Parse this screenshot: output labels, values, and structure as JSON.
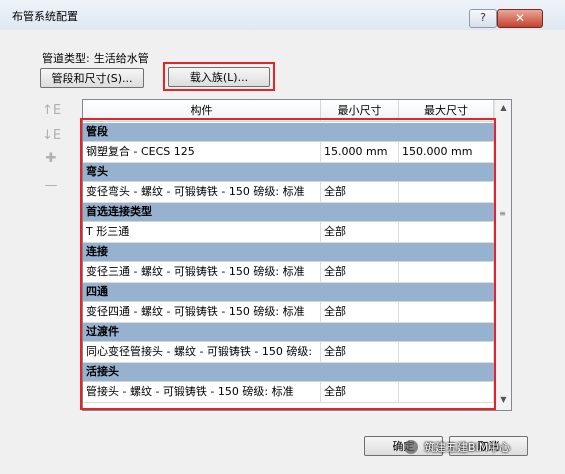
{
  "window": {
    "title": "布管系统配置",
    "help_label": "?",
    "close_label": "✕"
  },
  "pipe_type": {
    "label": "管道类型:",
    "value": "生活给水管"
  },
  "buttons": {
    "segments_label": "管段和尺寸(S)...",
    "load_family_label": "载入族(L)...",
    "ok_label": "确定",
    "cancel_label": "取消"
  },
  "side_icons": [
    {
      "name": "move-up-icon",
      "glyph": "↑E"
    },
    {
      "name": "move-down-icon",
      "glyph": "↓E"
    },
    {
      "name": "add-icon",
      "glyph": "✚"
    },
    {
      "name": "remove-icon",
      "glyph": "—"
    }
  ],
  "table": {
    "columns": [
      "构件",
      "最小尺寸",
      "最大尺寸"
    ],
    "groups": [
      {
        "name": "管段",
        "item": [
          "钢塑复合 - CECS 125",
          "15.000 mm",
          "150.000 mm"
        ]
      },
      {
        "name": "弯头",
        "item": [
          "变径弯头 - 螺纹 - 可锻铸铁 - 150 磅级: 标准",
          "全部",
          ""
        ]
      },
      {
        "name": "首选连接类型",
        "item": [
          "T 形三通",
          "全部",
          ""
        ]
      },
      {
        "name": "连接",
        "item": [
          "变径三通 - 螺纹 - 可锻铸铁 - 150 磅级: 标准",
          "全部",
          ""
        ]
      },
      {
        "name": "四通",
        "item": [
          "变径四通 - 螺纹 - 可锻铸铁 - 150 磅级: 标准",
          "全部",
          ""
        ]
      },
      {
        "name": "过渡件",
        "item": [
          "同心变径管接头 - 螺纹 - 可锻铸铁 - 150 磅级:",
          "全部",
          ""
        ]
      },
      {
        "name": "活接头",
        "item": [
          "管接头 - 螺纹 - 可锻铸铁 - 150 磅级: 标准",
          "全部",
          ""
        ]
      }
    ]
  },
  "watermark": "筑建五建BIM中心",
  "colors": {
    "group_row": "#97b2cf",
    "highlight": "#e0262b",
    "close_button": "#c8412d"
  }
}
